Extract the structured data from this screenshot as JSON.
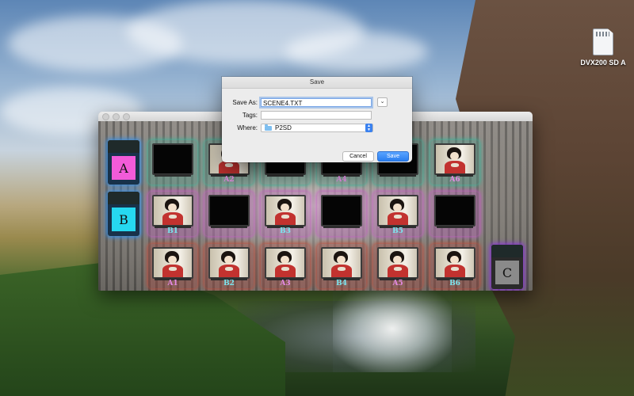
{
  "desktop": {
    "volume_icon": "sd-card-icon",
    "volume_label": "DVX200 SD A"
  },
  "dialog": {
    "title": "Save",
    "save_as_label": "Save As:",
    "save_as_value": "SCENE4.TXT",
    "tags_label": "Tags:",
    "tags_value": "",
    "where_label": "Where:",
    "where_value": "P2SD",
    "cancel_label": "Cancel",
    "save_label": "Save"
  },
  "app": {
    "cards": [
      {
        "letter": "A",
        "accent": "#f25bd9"
      },
      {
        "letter": "B",
        "accent": "#26d8f0"
      },
      {
        "letter": "C",
        "accent": "#8a8a8a"
      }
    ],
    "row1": [
      {
        "label": "",
        "has_image": false
      },
      {
        "label": "A2",
        "has_image": true
      },
      {
        "label": "",
        "has_image": false
      },
      {
        "label": "A4",
        "has_image": false
      },
      {
        "label": "",
        "has_image": false
      },
      {
        "label": "A6",
        "has_image": true
      }
    ],
    "row2": [
      {
        "label": "B1",
        "has_image": true
      },
      {
        "label": "",
        "has_image": false
      },
      {
        "label": "B3",
        "has_image": true
      },
      {
        "label": "",
        "has_image": false
      },
      {
        "label": "B5",
        "has_image": true
      },
      {
        "label": "",
        "has_image": false
      }
    ],
    "row3": [
      {
        "label": "A1",
        "has_image": true
      },
      {
        "label": "B2",
        "has_image": true
      },
      {
        "label": "A3",
        "has_image": true
      },
      {
        "label": "B4",
        "has_image": true
      },
      {
        "label": "A5",
        "has_image": true
      },
      {
        "label": "B6",
        "has_image": true
      }
    ]
  }
}
